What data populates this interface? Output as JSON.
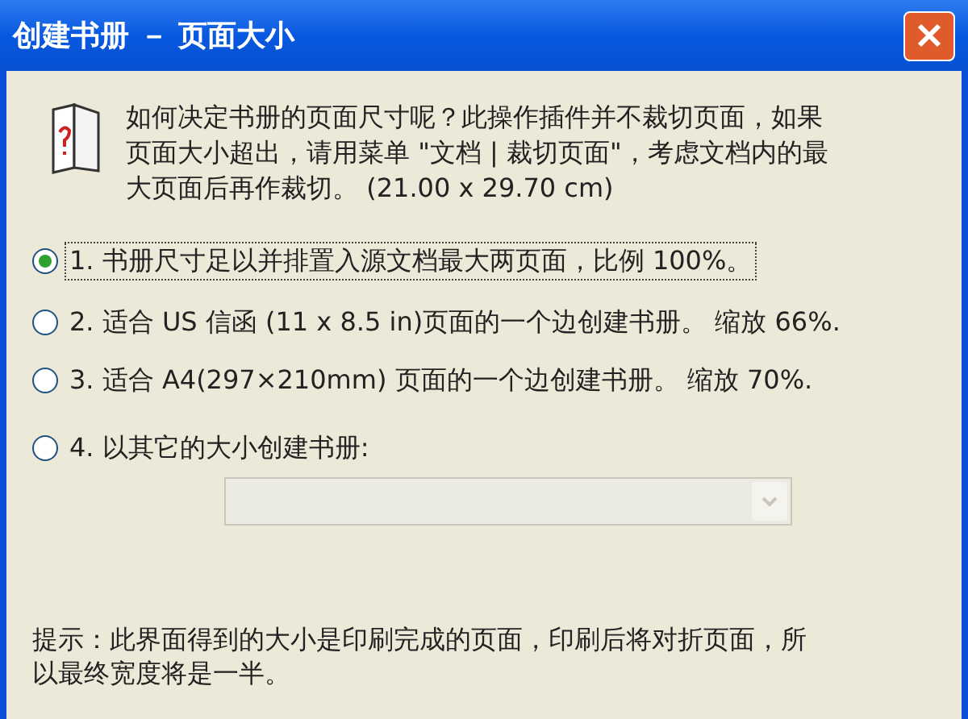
{
  "window": {
    "title": "创建书册 － 页面大小"
  },
  "intro": {
    "lines": [
      "如何决定书册的页面尺寸呢？此操作插件并不裁切页面，如果",
      "页面大小超出，请用菜单 \"文档 | 裁切页面\"，考虑文档内的最",
      "大页面后再作裁切。 (21.00 x 29.70 cm)"
    ]
  },
  "options": [
    {
      "label": "1. 书册尺寸足以并排置入源文档最大两页面，比例 100%。",
      "selected": true
    },
    {
      "label": "2. 适合 US 信函 (11 x 8.5 in)页面的一个边创建书册。 缩放 66%.",
      "selected": false
    },
    {
      "label": "3. 适合 A4(297×210mm) 页面的一个边创建书册。 缩放 70%.",
      "selected": false
    },
    {
      "label": "4. 以其它的大小创建书册:",
      "selected": false
    }
  ],
  "size_dropdown": {
    "disabled": true
  },
  "hint": {
    "lines": [
      "提示：此界面得到的大小是印刷完成的页面，印刷后将对折页面，所",
      "以最终宽度将是一半。"
    ]
  }
}
